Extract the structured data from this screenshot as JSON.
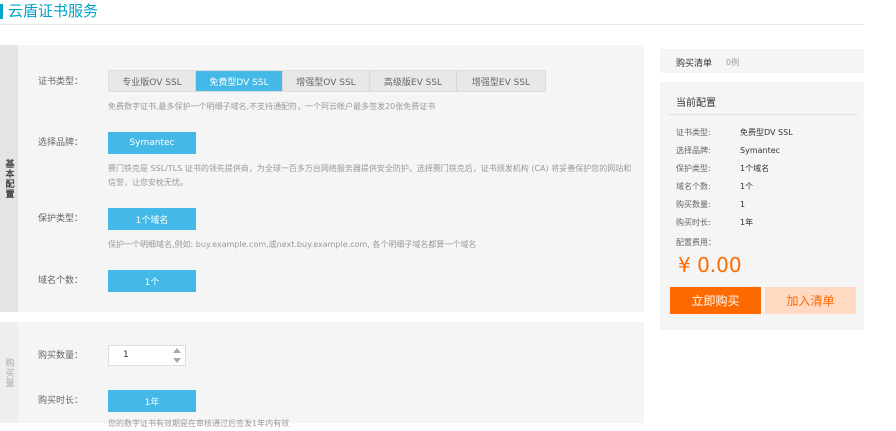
{
  "page": {
    "title": "云盾证书服务"
  },
  "sidebar": {
    "section1": "基本配置",
    "section2": "购买量"
  },
  "cert_type": {
    "label": "证书类型：",
    "options": [
      "专业版OV SSL",
      "免费型DV SSL",
      "增强型OV SSL",
      "高级版EV SSL",
      "增强型EV SSL"
    ],
    "selected_index": 1,
    "desc": "免费数字证书,最多保护一个明细子域名,不支持通配符，一个阿云帐户最多签发20张免费证书"
  },
  "brand": {
    "label": "选择品牌：",
    "value": "Symantec",
    "desc": "赛门铁克是 SSL/TLS 证书的领先提供商，为全球一百多万台网络服务器提供安全防护。选择赛门铁克后，证书颁发机构 (CA) 将妥善保护您的网站和信誉，让您安枕无忧。"
  },
  "protect_type": {
    "label": "保护类型：",
    "value": "1个域名",
    "desc": "保护一个明细域名,例如: buy.example.com,或next.buy.example.com, 各个明细子域名都算一个域名"
  },
  "domain_count": {
    "label": "域名个数：",
    "value": "1个"
  },
  "purchase": {
    "qty_label": "购买数量：",
    "qty_value": "1",
    "duration_label": "购买时长：",
    "duration_value": "1年",
    "footer_note": "您的数字证书有效期是在审核通过后签发1年内有效"
  },
  "cart": {
    "title": "购买清单",
    "count": "0例",
    "config_title": "当前配置",
    "rows": [
      {
        "k": "证书类型:",
        "v": "免费型DV SSL"
      },
      {
        "k": "选择品牌:",
        "v": "Symantec"
      },
      {
        "k": "保护类型:",
        "v": "1个域名"
      },
      {
        "k": "域名个数:",
        "v": "1个"
      },
      {
        "k": "购买数量:",
        "v": "1"
      },
      {
        "k": "购买时长:",
        "v": "1年"
      }
    ],
    "fee_label": "配置费用：",
    "price": "¥ 0.00",
    "buy_label": "立即购买",
    "add_label": "加入清单"
  },
  "colors": {
    "accent": "#44b8e6",
    "title_blue": "#00a2ca",
    "orange": "#ff6a00",
    "orange_light": "#ffd9c2"
  }
}
